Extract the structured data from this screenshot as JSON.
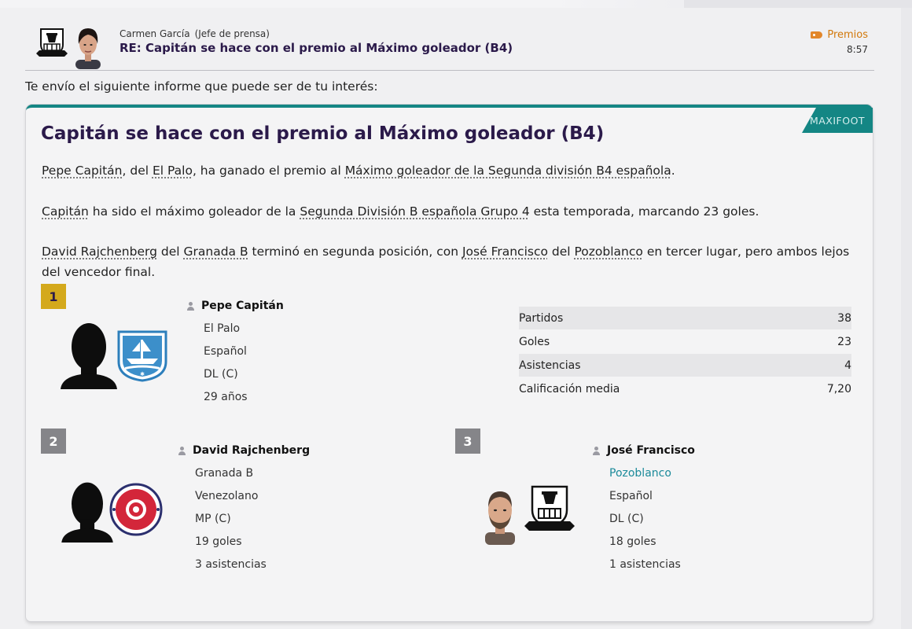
{
  "message": {
    "sender_name": "Carmen García",
    "sender_role": "(Jefe de prensa)",
    "subject": "RE: Capitán se hace con el premio al Máximo goleador (B4)",
    "tag": "Premios",
    "time": "8:57",
    "intro": "Te envío el siguiente informe que puede ser de tu interés:"
  },
  "article": {
    "source": "MAXIFOOT",
    "title": "Capitán se hace con el premio al Máximo goleador (B4)",
    "p1": {
      "player": "Pepe Capitán",
      "t1": ", del ",
      "club": "El Palo",
      "t2": ", ha ganado el premio al ",
      "award": "Máximo goleador de la Segunda división B4 española",
      "t3": "."
    },
    "p2": {
      "player": "Capitán",
      "t1": " ha sido el máximo goleador de la ",
      "league": "Segunda División B española Grupo 4",
      "t2": " esta temporada, marcando 23 goles."
    },
    "p3": {
      "p2name": "David Rajchenberg",
      "t1": " del ",
      "p2club": "Granada B",
      "t2": " terminó en segunda posición, con ",
      "p3name": "José Francisco",
      "t3": " del ",
      "p3club": "Pozoblanco",
      "t4": " en tercer lugar, pero ambos lejos del vencedor final."
    }
  },
  "winner": {
    "rank": "1",
    "name": "Pepe Capitán",
    "club": "El Palo",
    "nationality": "Español",
    "position": "DL (C)",
    "age": "29 años",
    "stats": [
      {
        "label": "Partidos",
        "value": "38"
      },
      {
        "label": "Goles",
        "value": "23"
      },
      {
        "label": "Asistencias",
        "value": "4"
      },
      {
        "label": "Calificación media",
        "value": "7,20"
      }
    ]
  },
  "second": {
    "rank": "2",
    "name": "David Rajchenberg",
    "club": "Granada B",
    "nationality": "Venezolano",
    "position": "MP (C)",
    "goals": "19 goles",
    "assists": "3 asistencias"
  },
  "third": {
    "rank": "3",
    "name": "José Francisco",
    "club": "Pozoblanco",
    "nationality": "Español",
    "position": "DL (C)",
    "goals": "18 goles",
    "assists": "1 asistencias"
  },
  "colors": {
    "accent": "#148684",
    "title": "#2b1a4a",
    "gold": "#d4a91c",
    "tag": "#d2780a"
  },
  "icons": [
    "club-crest-icon",
    "person-icon",
    "tag-icon",
    "silhouette-icon"
  ]
}
